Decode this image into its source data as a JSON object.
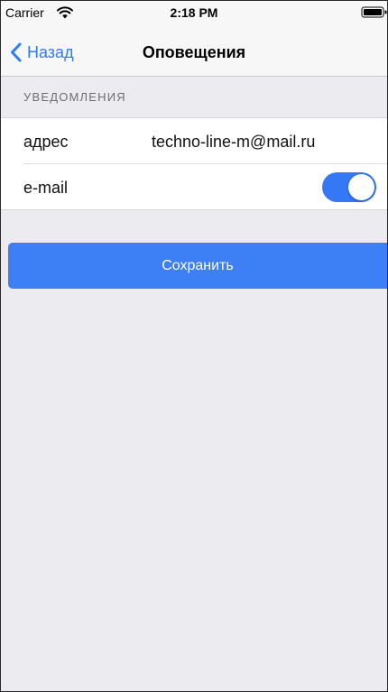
{
  "status_bar": {
    "carrier": "Carrier",
    "time": "2:18 PM",
    "wifi_icon": "wifi-icon",
    "battery_icon": "battery-icon"
  },
  "nav": {
    "back_label": "Назад",
    "back_icon": "chevron-left-icon",
    "title": "Оповещения"
  },
  "section": {
    "header": "УВЕДОМЛЕНИЯ"
  },
  "rows": {
    "address": {
      "label": "адрес",
      "value": "techno-line-m@mail.ru"
    },
    "email": {
      "label": "e-mail",
      "toggle_on": true
    }
  },
  "save_button": {
    "label": "Сохранить"
  },
  "colors": {
    "accent": "#3478f6",
    "button": "#3d7ff5",
    "background": "#ebebf0",
    "bar": "#f7f7f7"
  }
}
